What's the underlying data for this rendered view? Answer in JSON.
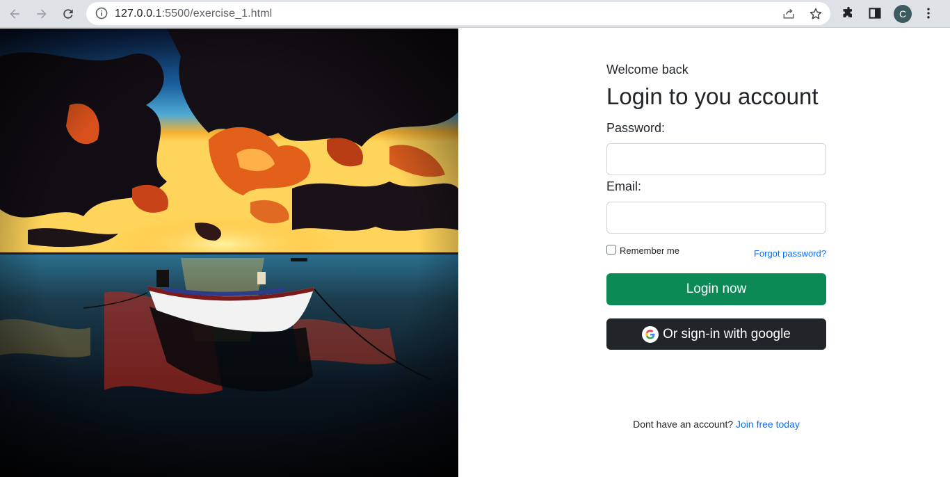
{
  "browser": {
    "url_host": "127.0.0.1",
    "url_path": ":5500/exercise_1.html",
    "avatar_letter": "C"
  },
  "icons": {
    "back": "back-arrow-icon",
    "forward": "forward-arrow-icon",
    "reload": "reload-icon",
    "site_info": "info-icon",
    "share": "share-icon",
    "bookmark": "star-icon",
    "extensions": "puzzle-icon",
    "side_panel": "side-panel-icon",
    "menu": "kebab-menu-icon",
    "google": "google-logo-icon"
  },
  "login": {
    "welcome": "Welcome back",
    "title": "Login to you account",
    "password_label": "Password:",
    "password_value": "",
    "email_label": "Email:",
    "email_value": "",
    "remember_label": "Remember me",
    "remember_checked": false,
    "forgot_link": "Forgot password?",
    "login_button": "Login now",
    "google_button": "Or sign-in with google",
    "signup_text": "Dont have an account?",
    "signup_link": "Join free today"
  },
  "colors": {
    "login_button": "#0b8a56",
    "google_button": "#212529",
    "link": "#0d6efd"
  }
}
